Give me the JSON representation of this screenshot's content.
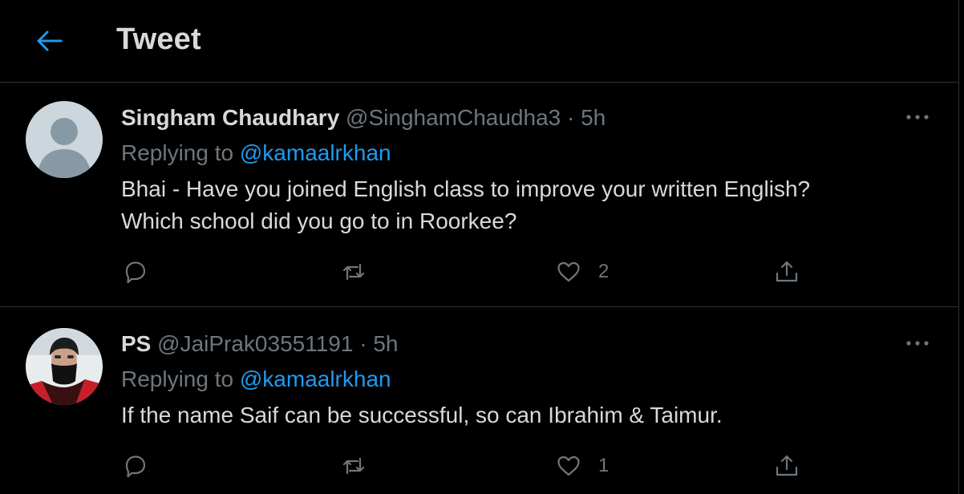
{
  "header": {
    "title": "Tweet",
    "back_icon": "arrow-left-icon",
    "accent": "#1d9bf0"
  },
  "tweets": [
    {
      "name": "Singham Chaudhary",
      "handle": "@SinghamChaudha3",
      "separator": "·",
      "time": "5h",
      "replying_prefix": "Replying to",
      "replying_to": "@kamaalrkhan",
      "body_lines": [
        "Bhai - Have you joined English class to improve your written English?",
        "Which school did you go to in Roorkee?"
      ],
      "likes": "2",
      "avatar": "default-profile-avatar"
    },
    {
      "name": "PS",
      "handle": "@JaiPrak03551191",
      "separator": "·",
      "time": "5h",
      "replying_prefix": "Replying to",
      "replying_to": "@kamaalrkhan",
      "body_lines": [
        "If the name Saif can be successful, so can Ibrahim & Taimur."
      ],
      "likes": "1",
      "avatar": "user-photo-avatar"
    }
  ],
  "colors": {
    "background": "#000000",
    "text": "#d9d9d9",
    "muted": "#6e767d",
    "link": "#1d9bf0",
    "divider": "#2f3336"
  }
}
